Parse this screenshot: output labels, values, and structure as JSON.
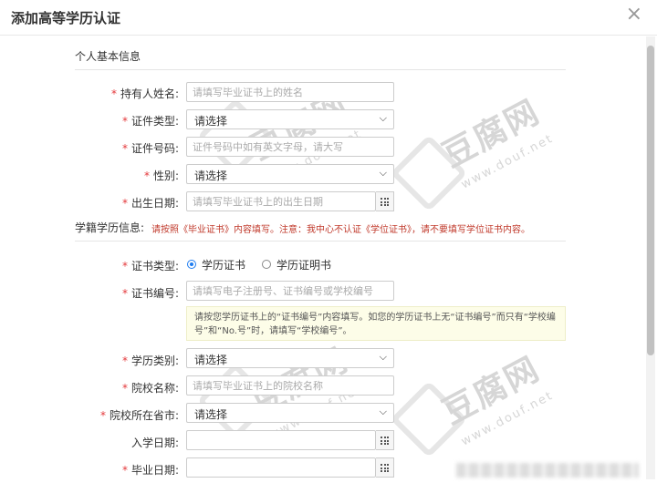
{
  "dialog": {
    "title": "添加高等学历认证",
    "close_symbol": "×"
  },
  "section_basic": {
    "title": "个人基本信息"
  },
  "fields_basic": {
    "name": {
      "label": "持有人姓名:",
      "placeholder": "请填写毕业证书上的姓名"
    },
    "id_type": {
      "label": "证件类型:",
      "value": "请选择"
    },
    "id_number": {
      "label": "证件号码:",
      "placeholder": "证件号码中如有英文字母，请大写"
    },
    "gender": {
      "label": "性别:",
      "value": "请选择"
    },
    "birth_date": {
      "label": "出生日期:",
      "placeholder": "请填写毕业证书上的出生日期"
    }
  },
  "section_edu": {
    "title": "学籍学历信息:",
    "note": "请按照《毕业证书》内容填写。注意：我中心不认证《学位证书》，请不要填写学位证书内容。"
  },
  "fields_edu": {
    "cert_type": {
      "label": "证书类型:",
      "option1": "学历证书",
      "option2": "学历证明书"
    },
    "cert_number": {
      "label": "证书编号:",
      "placeholder": "请填写电子注册号、证书编号或学校编号"
    },
    "tip": "请按您学历证书上的“证书编号”内容填写。如您的学历证书上无“证书编号”而只有“学校编号”和“No.号”时，请填写“学校编号”。",
    "edu_category": {
      "label": "学历类别:",
      "value": "请选择"
    },
    "school_name": {
      "label": "院校名称:",
      "placeholder": "请填写毕业证书上的院校名称"
    },
    "school_province": {
      "label": "院校所在省市:",
      "value": "请选择"
    },
    "enroll_date": {
      "label": "入学日期:"
    },
    "grad_date": {
      "label": "毕业日期:"
    }
  },
  "required_mark": "*",
  "watermark": {
    "brand": "豆腐网",
    "url": "www.douf.net"
  }
}
